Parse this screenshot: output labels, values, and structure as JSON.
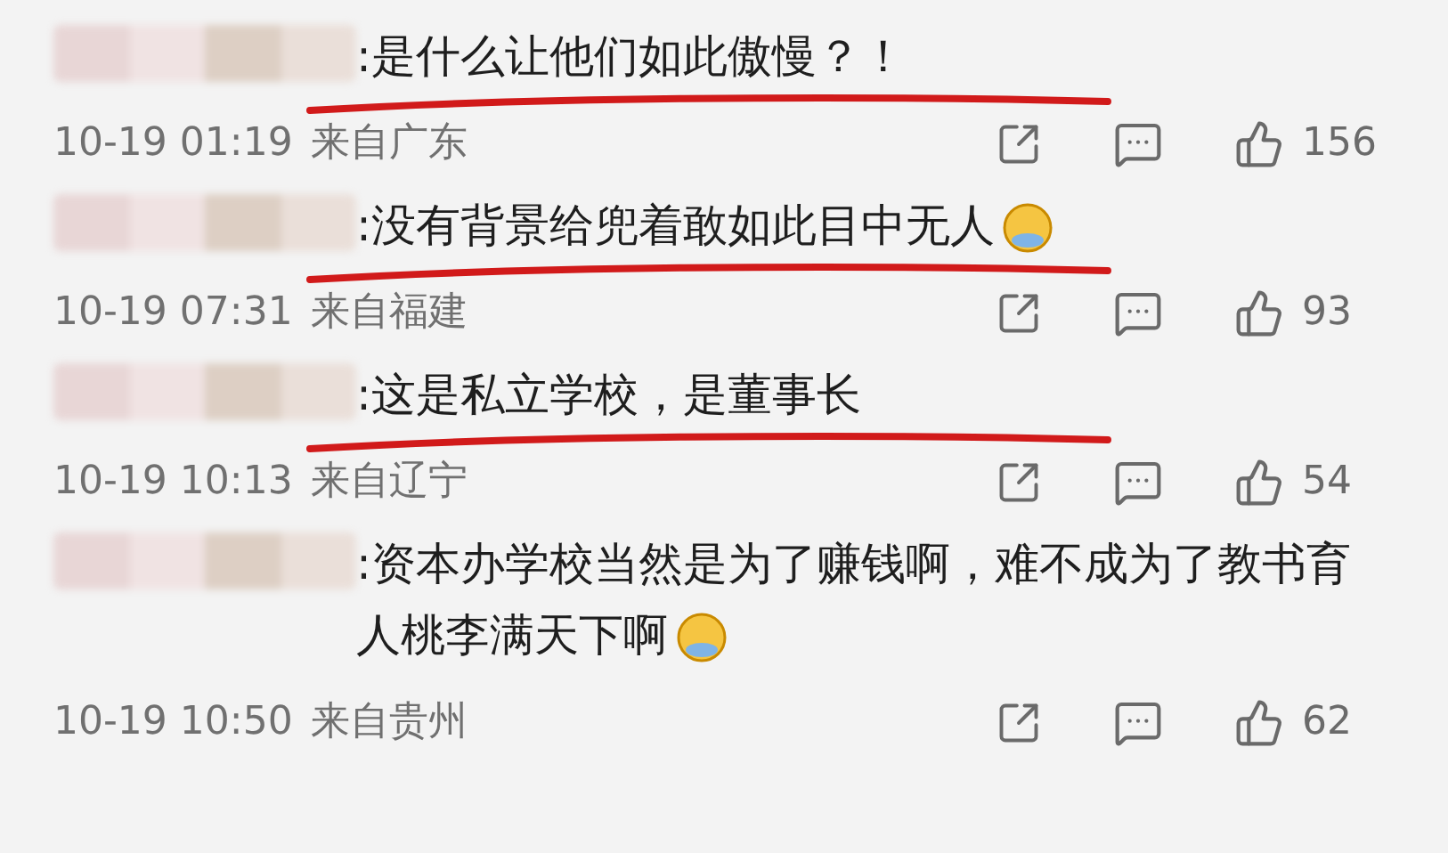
{
  "comments": [
    {
      "text": ":是什么让他们如此傲慢？！",
      "emoji": false,
      "underlined": true,
      "time": "10-19 01:19",
      "location": "来自广东",
      "likes": "156"
    },
    {
      "text": ":没有背景给兜着敢如此目中无人",
      "emoji": true,
      "underlined": true,
      "time": "10-19 07:31",
      "location": "来自福建",
      "likes": "93"
    },
    {
      "text": ":这是私立学校，是董事长",
      "emoji": false,
      "underlined": true,
      "time": "10-19 10:13",
      "location": "来自辽宁",
      "likes": "54"
    },
    {
      "text": ":资本办学校当然是为了赚钱啊，难不成为了教书育人桃李满天下啊",
      "emoji": true,
      "underlined": false,
      "time": "10-19 10:50",
      "location": "来自贵州",
      "likes": "62"
    }
  ]
}
